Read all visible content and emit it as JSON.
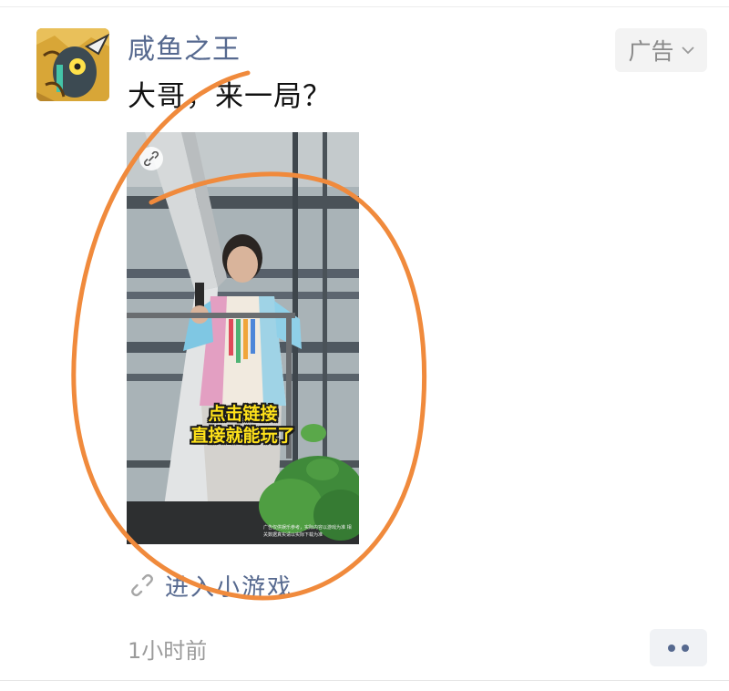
{
  "post": {
    "username": "咸鱼之王",
    "text": "大哥，来一局？",
    "ad_label": "广告",
    "time": "1小时前"
  },
  "media": {
    "caption_line1": "点击链接",
    "caption_line2": "直接就能玩了",
    "disclaimer": "广告仅供娱乐参考，实际内容以游戏为准 相关数据真实请以实际下载为准"
  },
  "mini_program": {
    "label": "进入小游戏"
  },
  "icons": {
    "link": "link-icon",
    "chevron": "chevron-down-icon",
    "more": "more-dots-icon"
  },
  "colors": {
    "username": "#56698f",
    "annotation_stroke": "#f08a3c",
    "caption": "#ffe21a"
  }
}
